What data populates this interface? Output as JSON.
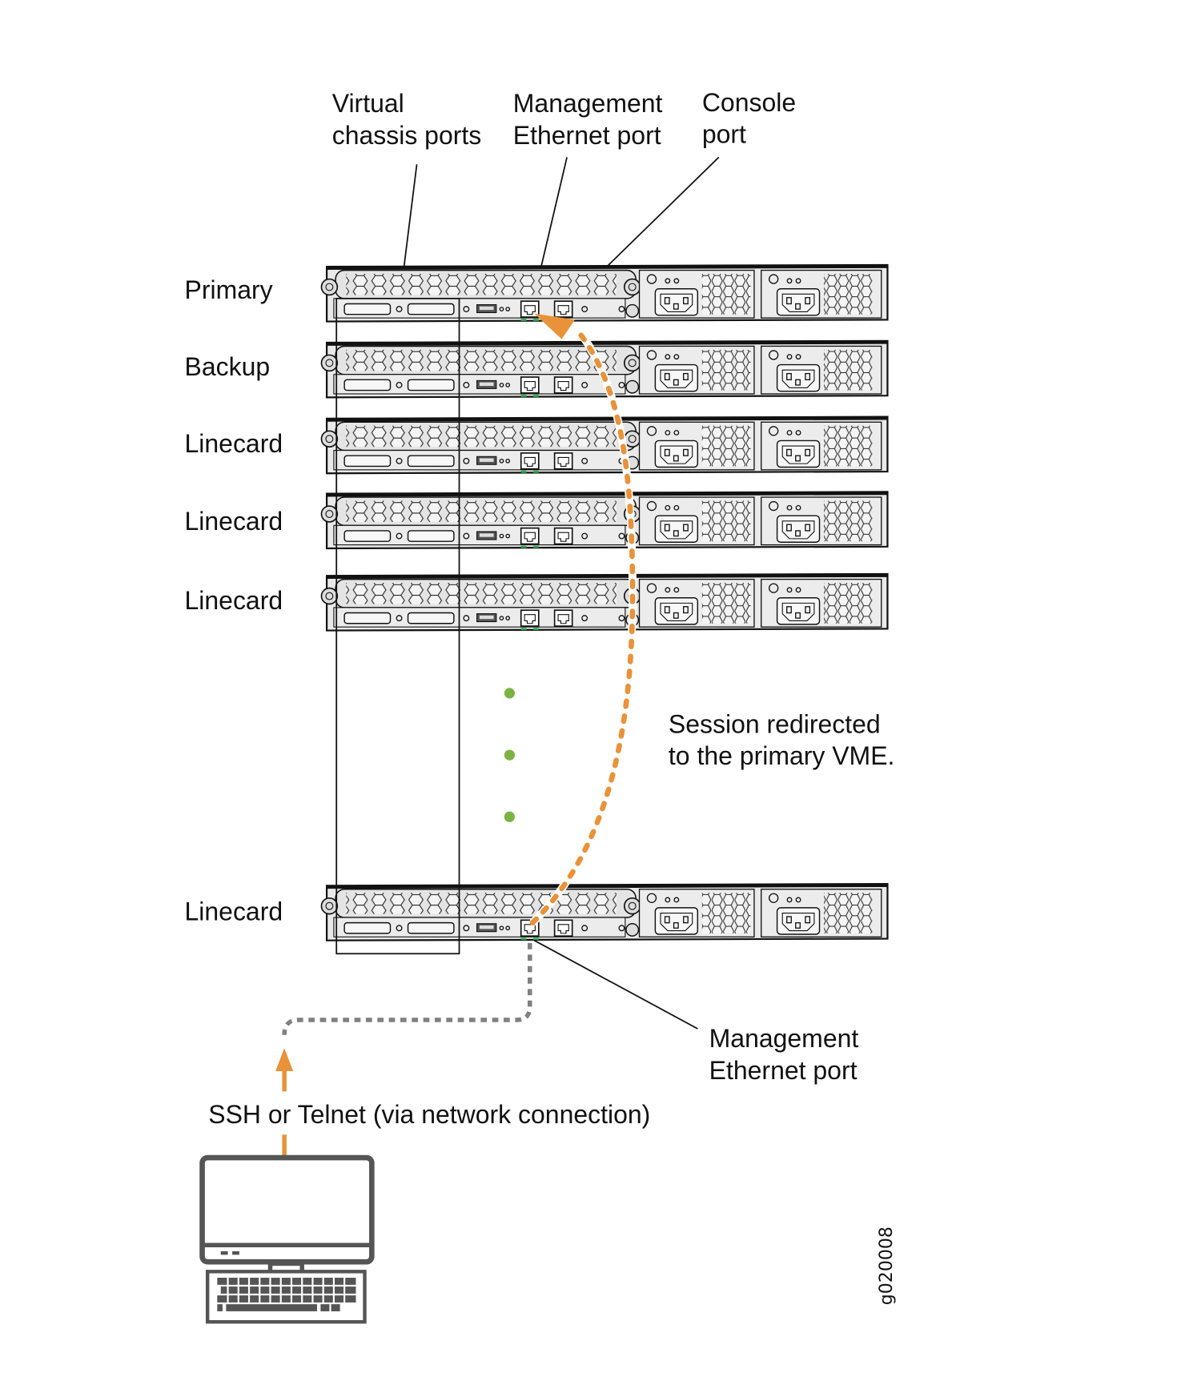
{
  "figure_id": "g020008",
  "callouts": {
    "vc_ports": [
      "Virtual",
      "chassis ports"
    ],
    "mgmt_top": [
      "Management",
      "Ethernet port"
    ],
    "console": [
      "Console",
      "port"
    ],
    "mgmt_bottom": [
      "Management",
      "Ethernet port"
    ],
    "session": [
      "Session redirected",
      "to the primary VME."
    ],
    "ssh": "SSH or Telnet (via network connection)"
  },
  "members": [
    {
      "role": "Primary"
    },
    {
      "role": "Backup"
    },
    {
      "role": "Linecard"
    },
    {
      "role": "Linecard"
    },
    {
      "role": "Linecard"
    },
    {
      "role": "Linecard"
    }
  ],
  "colors": {
    "redirect_path": "#e8923a",
    "network_path": "#808080",
    "ellipsis_dots": "#7ab342",
    "link_led": "#2aa84a",
    "computer": "#555555"
  }
}
